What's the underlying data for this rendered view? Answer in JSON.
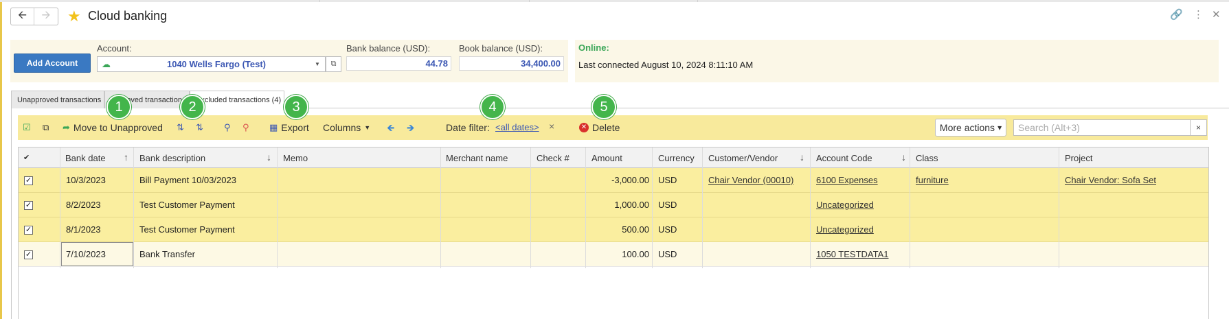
{
  "window": {
    "title": "Cloud banking"
  },
  "account": {
    "add_label": "Add Account",
    "account_label": "Account:",
    "account_value": "1040 Wells Fargo (Test)",
    "bank_balance_label": "Bank balance (USD):",
    "bank_balance": "44.78",
    "book_balance_label": "Book balance (USD):",
    "book_balance": "34,400.00",
    "online_label": "Online:",
    "last_connected": "Last connected August 10, 2024 8:11:10 AM"
  },
  "tabs": [
    {
      "label": "Unapproved transactions"
    },
    {
      "label": "Approved transactions"
    },
    {
      "label": "Excluded transactions (4)"
    }
  ],
  "toolbar": {
    "move_label": "Move to Unapproved",
    "export_label": "Export",
    "columns_label": "Columns",
    "date_filter_label": "Date filter:",
    "date_filter_value": "<all dates>",
    "date_clear": "×",
    "delete_label": "Delete",
    "more_actions_label": "More actions",
    "search_placeholder": "Search (Alt+3)",
    "search_clear": "×"
  },
  "callouts": [
    "1",
    "2",
    "3",
    "4",
    "5"
  ],
  "table": {
    "columns": [
      "Bank date",
      "Bank description",
      "Memo",
      "Merchant name",
      "Check #",
      "Amount",
      "Currency",
      "Customer/Vendor",
      "Account Code",
      "Class",
      "Project"
    ],
    "rows": [
      {
        "date": "10/3/2023",
        "description": "Bill Payment 10/03/2023",
        "memo": "",
        "merchant": "",
        "check": "",
        "amount": "-3,000.00",
        "currency": "USD",
        "customer": "Chair Vendor (00010)",
        "account_code": "6100 Expenses",
        "class": "furniture",
        "project": "Chair Vendor: Sofa Set"
      },
      {
        "date": "8/2/2023",
        "description": "Test Customer Payment",
        "memo": "",
        "merchant": "",
        "check": "",
        "amount": "1,000.00",
        "currency": "USD",
        "customer": "",
        "account_code": "Uncategorized",
        "class": "",
        "project": ""
      },
      {
        "date": "8/1/2023",
        "description": "Test Customer Payment",
        "memo": "",
        "merchant": "",
        "check": "",
        "amount": "500.00",
        "currency": "USD",
        "customer": "",
        "account_code": "Uncategorized",
        "class": "",
        "project": ""
      },
      {
        "date": "7/10/2023",
        "description": "Bank Transfer",
        "memo": "",
        "merchant": "",
        "check": "",
        "amount": "100.00",
        "currency": "USD",
        "customer": "",
        "account_code": "1050 TESTDATA1",
        "class": "",
        "project": ""
      }
    ]
  },
  "colors": {
    "accent_blue": "#3a79c2",
    "toolbar_bg": "#f8ea9c",
    "selected_row": "#faee9f",
    "callout_green": "#43b54b",
    "online_green": "#3aa657"
  }
}
